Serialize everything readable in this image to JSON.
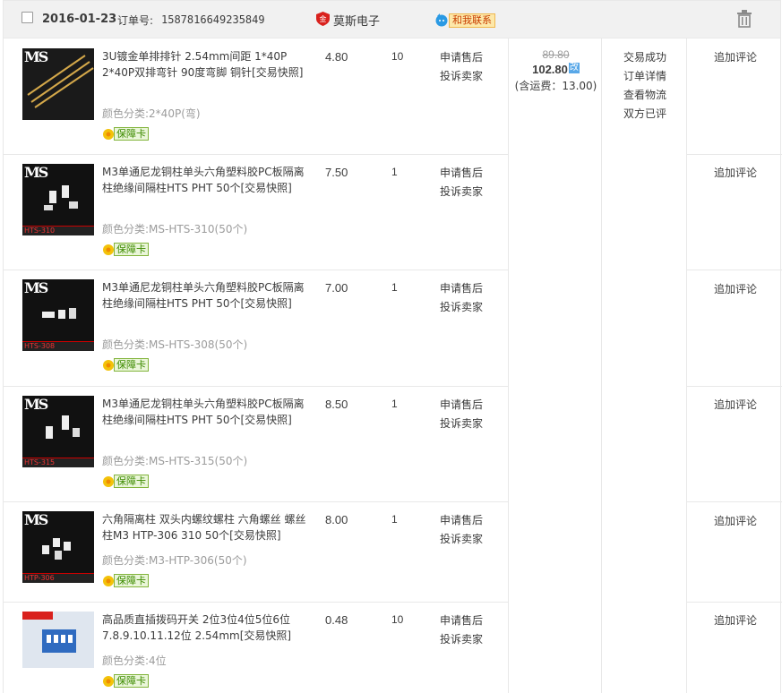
{
  "header": {
    "date": "2016-01-23",
    "order_label": "订单号:",
    "order_no": "1587816649235849",
    "shop": "莫斯电子",
    "contact": "和我联系"
  },
  "items": [
    {
      "title": "3U镀金单排排针 2.54mm间距 1*40P 2*40P双排弯针 90度弯脚 铜针[交易快照]",
      "attr_label": "颜色分类:",
      "attr_value": "2*40P(弯)",
      "badge": "保障卡",
      "price": "4.80",
      "qty": "10",
      "op1": "申请售后",
      "op2": "投诉卖家",
      "review": "追加评论",
      "thumb_tag": "",
      "thumb_logo": "MS"
    },
    {
      "title": "M3单通尼龙铜柱单头六角塑料胶PC板隔离柱绝缘间隔柱HTS PHT 50个[交易快照]",
      "attr_label": "颜色分类:",
      "attr_value": "MS-HTS-310(50个)",
      "badge": "保障卡",
      "price": "7.50",
      "qty": "1",
      "op1": "申请售后",
      "op2": "投诉卖家",
      "review": "追加评论",
      "thumb_tag": "HTS-310",
      "thumb_logo": "MS"
    },
    {
      "title": "M3单通尼龙铜柱单头六角塑料胶PC板隔离柱绝缘间隔柱HTS PHT 50个[交易快照]",
      "attr_label": "颜色分类:",
      "attr_value": "MS-HTS-308(50个)",
      "badge": "保障卡",
      "price": "7.00",
      "qty": "1",
      "op1": "申请售后",
      "op2": "投诉卖家",
      "review": "追加评论",
      "thumb_tag": "HTS-308",
      "thumb_logo": "MS"
    },
    {
      "title": "M3单通尼龙铜柱单头六角塑料胶PC板隔离柱绝缘间隔柱HTS PHT 50个[交易快照]",
      "attr_label": "颜色分类:",
      "attr_value": "MS-HTS-315(50个)",
      "badge": "保障卡",
      "price": "8.50",
      "qty": "1",
      "op1": "申请售后",
      "op2": "投诉卖家",
      "review": "追加评论",
      "thumb_tag": "HTS-315",
      "thumb_logo": "MS"
    },
    {
      "title": "六角隔离柱 双头内螺纹螺柱 六角螺丝 螺丝柱M3 HTP-306 310 50个[交易快照]",
      "attr_label": "颜色分类:",
      "attr_value": "M3-HTP-306(50个)",
      "badge": "保障卡",
      "price": "8.00",
      "qty": "1",
      "op1": "申请售后",
      "op2": "投诉卖家",
      "review": "追加评论",
      "thumb_tag": "HTP-306",
      "thumb_logo": "MS"
    },
    {
      "title": "高品质直插拨码开关 2位3位4位5位6位7.8.9.10.11.12位 2.54mm[交易快照]",
      "attr_label": "颜色分类:",
      "attr_value": "4位",
      "badge": "保障卡",
      "price": "0.48",
      "qty": "10",
      "op1": "申请售后",
      "op2": "投诉卖家",
      "review": "追加评论",
      "thumb_tag": "",
      "thumb_logo": ""
    }
  ],
  "totals": {
    "original": "89.80",
    "paid": "102.80",
    "changed_tag": "改",
    "shipping": "(含运费：13.00)"
  },
  "status": {
    "line1": "交易成功",
    "line2": "订单详情",
    "line3": "查看物流",
    "line4": "双方已评"
  },
  "colors": {
    "header_bg": "#f1f1f1",
    "border": "#e8e8e8",
    "badge_green": "#3d8b00",
    "contact_orange": "#c83c00"
  }
}
